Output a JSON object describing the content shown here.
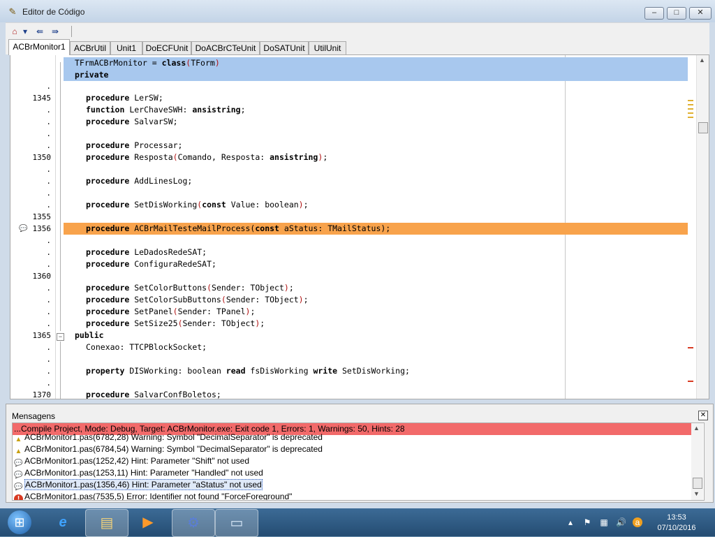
{
  "window": {
    "title": "Editor de Código",
    "controls": {
      "minimize": "‒",
      "maximize": "□",
      "close": "✕"
    }
  },
  "toolbar": {
    "buttons": [
      "home-icon",
      "dropdown-arrow-icon",
      "jump-back-icon",
      "jump-forward-icon"
    ]
  },
  "tabs": [
    {
      "label": "ACBrMonitor1",
      "active": true
    },
    {
      "label": "ACBrUtil"
    },
    {
      "label": "Unit1"
    },
    {
      "label": "DoECFUnit"
    },
    {
      "label": "DoACBrCTeUnit"
    },
    {
      "label": "DoSATUnit"
    },
    {
      "label": "UtilUnit"
    }
  ],
  "editor": {
    "line_numbers": [
      ".",
      "1345",
      ".",
      ".",
      ".",
      ".",
      "1350",
      ".",
      ".",
      ".",
      ".",
      "1355",
      "1356",
      ".",
      ".",
      ".",
      "1360",
      ".",
      ".",
      ".",
      ".",
      "1365",
      ".",
      ".",
      ".",
      ".",
      "1370"
    ],
    "lines": [
      {
        "kind": "blue",
        "text": "TFrmACBrMonitor = class(TForm)"
      },
      {
        "kind": "blue",
        "text": "private"
      },
      {
        "kind": "",
        "text": ""
      },
      {
        "kind": "",
        "text": "procedure LerSW;"
      },
      {
        "kind": "",
        "text": "function LerChaveSWH: ansistring;"
      },
      {
        "kind": "",
        "text": "procedure SalvarSW;"
      },
      {
        "kind": "",
        "text": ""
      },
      {
        "kind": "",
        "text": "procedure Processar;"
      },
      {
        "kind": "",
        "text": "procedure Resposta(Comando, Resposta: ansistring);"
      },
      {
        "kind": "",
        "text": ""
      },
      {
        "kind": "",
        "text": "procedure AddLinesLog;"
      },
      {
        "kind": "",
        "text": ""
      },
      {
        "kind": "",
        "text": "procedure SetDisWorking(const Value: boolean);"
      },
      {
        "kind": "",
        "text": ""
      },
      {
        "kind": "orange",
        "text": "procedure ACBrMailTesteMailProcess(const aStatus: TMailStatus);"
      },
      {
        "kind": "",
        "text": ""
      },
      {
        "kind": "",
        "text": "procedure LeDadosRedeSAT;"
      },
      {
        "kind": "",
        "text": "procedure ConfiguraRedeSAT;"
      },
      {
        "kind": "",
        "text": ""
      },
      {
        "kind": "",
        "text": "procedure SetColorButtons(Sender: TObject);"
      },
      {
        "kind": "",
        "text": "procedure SetColorSubButtons(Sender: TObject);"
      },
      {
        "kind": "",
        "text": "procedure SetPanel(Sender: TPanel);"
      },
      {
        "kind": "",
        "text": "procedure SetSize25(Sender: TObject);"
      },
      {
        "kind": "",
        "text": "public"
      },
      {
        "kind": "",
        "text": "Conexao: TTCPBlockSocket;"
      },
      {
        "kind": "",
        "text": ""
      },
      {
        "kind": "",
        "text": "property DISWorking: boolean read fsDisWorking write SetDisWorking;"
      },
      {
        "kind": "",
        "text": ""
      },
      {
        "kind": "",
        "text": "procedure SalvarConfBoletos;"
      }
    ]
  },
  "messages": {
    "title": "Mensagens",
    "close_label": "✕",
    "summary": "...Compile Project, Mode: Debug, Target: ACBrMonitor.exe: Exit code 1, Errors: 1, Warnings: 50, Hints: 28",
    "rows": [
      {
        "type": "warning",
        "text": "ACBrMonitor1.pas(6782,28) Warning: Symbol \"DecimalSeparator\" is deprecated"
      },
      {
        "type": "warning",
        "text": "ACBrMonitor1.pas(6784,54) Warning: Symbol \"DecimalSeparator\" is deprecated"
      },
      {
        "type": "hint",
        "text": "ACBrMonitor1.pas(1252,42) Hint: Parameter \"Shift\" not used"
      },
      {
        "type": "hint",
        "text": "ACBrMonitor1.pas(1253,11) Hint: Parameter \"Handled\" not used"
      },
      {
        "type": "hint",
        "text": "ACBrMonitor1.pas(1356,46) Hint: Parameter \"aStatus\" not used",
        "selected": true
      },
      {
        "type": "error",
        "text": "ACBrMonitor1.pas(7535,5) Error: Identifier not found \"ForceForeground\""
      }
    ]
  },
  "taskbar": {
    "apps": [
      "internet-explorer-icon",
      "file-explorer-icon",
      "media-player-icon",
      "lazarus-ide-icon",
      "notepad-icon"
    ],
    "time": "13:53",
    "date": "07/10/2016"
  },
  "colors": {
    "current_line": "#a8c8ee",
    "hint_line": "#f8a34c",
    "error_summary": "#f26a6a"
  }
}
